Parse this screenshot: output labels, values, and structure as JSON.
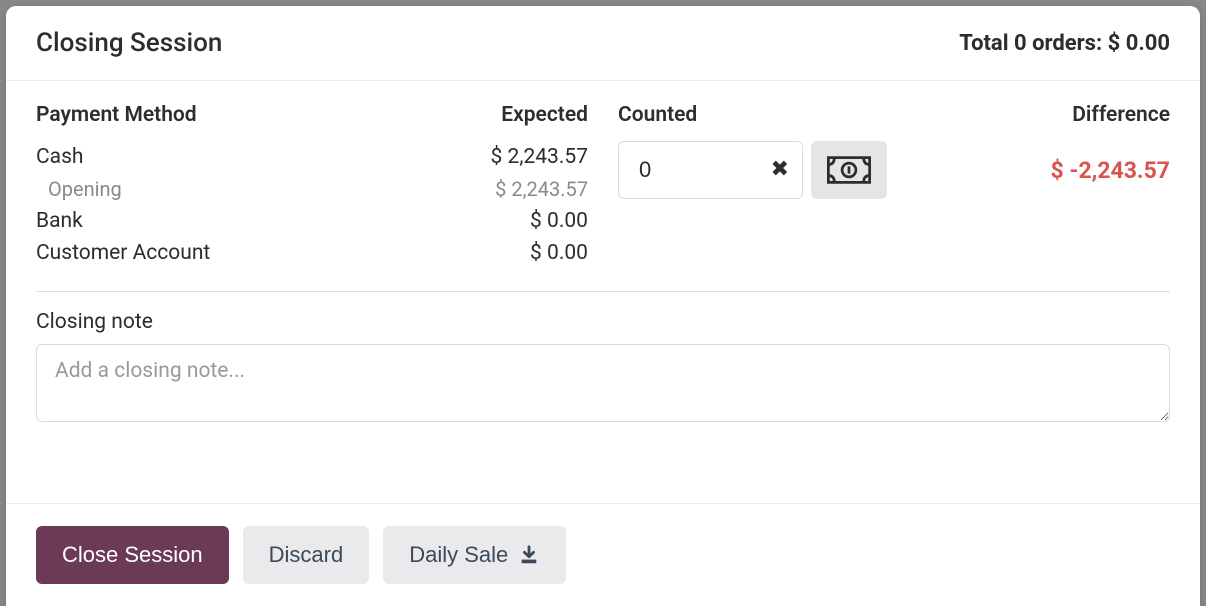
{
  "header": {
    "title": "Closing Session",
    "total_text": "Total 0 orders: $ 0.00"
  },
  "columns": {
    "payment_method": "Payment Method",
    "expected": "Expected",
    "counted": "Counted",
    "difference": "Difference"
  },
  "payment_methods": {
    "cash": {
      "label": "Cash",
      "expected": "$ 2,243.57"
    },
    "opening": {
      "label": "Opening",
      "expected": "$ 2,243.57"
    },
    "bank": {
      "label": "Bank",
      "expected": "$ 0.00"
    },
    "customer_account": {
      "label": "Customer Account",
      "expected": "$ 0.00"
    }
  },
  "counted": {
    "value": "0",
    "difference": "$ -2,243.57"
  },
  "colors": {
    "difference_negative": "#d9534f",
    "primary_button": "#6b3a57"
  },
  "note": {
    "label": "Closing note",
    "placeholder": "Add a closing note..."
  },
  "footer": {
    "close_session": "Close Session",
    "discard": "Discard",
    "daily_sale": "Daily Sale"
  }
}
